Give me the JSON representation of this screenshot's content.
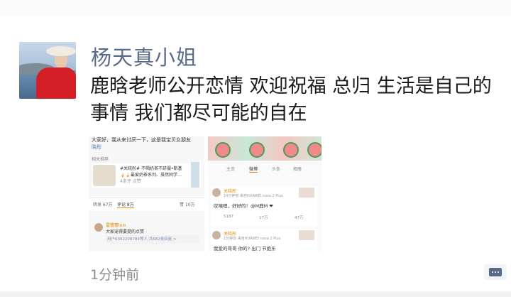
{
  "post": {
    "author": "杨天真小姐",
    "text": "鹿晗老师公开恋情 欢迎祝福 总归 生活是自己的事情 我们都尽可能的自在",
    "time": "1分钟前"
  },
  "image_left": {
    "fragment_top": "大家好，我从来讨厌一下，这是我宝贝女朋友",
    "fragment_link": "晓彤",
    "section_label": "相关推荐",
    "card_line1": "#关晓彤# 不喝奶茶不舒服•斯基",
    "card_line2": "🍦🍦最爱奶茶系列、虽然同学…",
    "card_line3": "4条评 点赞",
    "stats": [
      "转发 67万",
      "评论 8万",
      "赞 10万"
    ],
    "comment_name": "雷蕾蕾lolo",
    "comment_text": "大家宠得要提的点赞",
    "comment_reply": "用户6362208784等人 共682条回复 >"
  },
  "image_right": {
    "tabs": [
      "主页",
      "微博",
      "头条",
      "相册"
    ],
    "active_tab": "微博",
    "posts": [
      {
        "name": "关晓彤",
        "meta": "14分钟前 来自HUAWEI nova 2 Plus",
        "text": "叹咦噢，好好的！@M鹿M ❤",
        "actions": [
          "5187",
          "17万",
          "47万"
        ]
      },
      {
        "name": "关晓彤",
        "meta": "1分钟前 来自HUAWEI nova 2 Plus",
        "text": "我爱的哥哥 你的? 出门 节绝乐",
        "actions": []
      }
    ]
  },
  "colors": {
    "author_name": "#5a6b8a",
    "text": "#1a1a1a",
    "time": "#8c8c8c",
    "weibo_orange": "#e68a00"
  },
  "icons": {
    "comment": "comment-bubble-icon"
  }
}
